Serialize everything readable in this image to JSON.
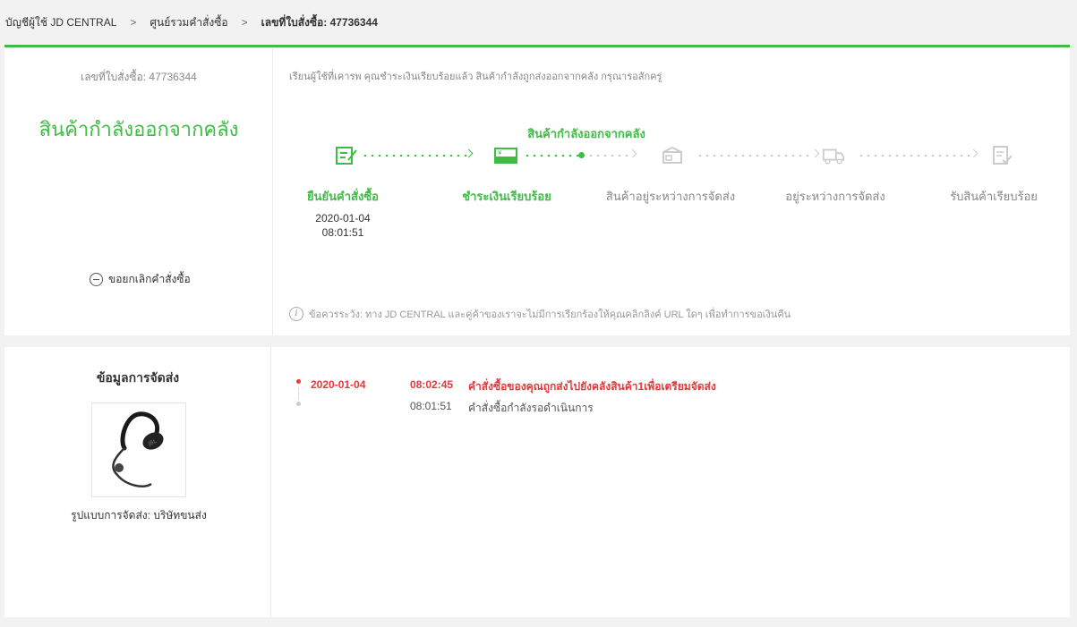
{
  "breadcrumb": {
    "account": "บัญชีผู้ใช้ JD CENTRAL",
    "separator": ">",
    "orders": "ศูนย์รวมคำสั่งซื้อ",
    "current": "เลขที่ใบสั่งซื้อ: 47736344"
  },
  "order": {
    "number_label": "เลขที่ใบสั่งซื้อ: 47736344",
    "status": "สินค้ากำลังออกจากคลัง",
    "cancel_label": "ขอยกเลิกคำสั่งซื้อ"
  },
  "progress": {
    "greeting": "เรียนผู้ใช้ที่เคารพ คุณชำระเงินเรียบร้อยแล้ว สินค้ากำลังถูกส่งออกจากคลัง กรุณารอสักครู่",
    "current_label": "สินค้ากำลังออกจากคลัง",
    "steps": [
      {
        "label": "ยืนยันคำสั่งซื้อ",
        "date": "2020-01-04",
        "time": "08:01:51",
        "icon": "order-confirm-icon",
        "done": true
      },
      {
        "label": "ชำระเงินเรียบร้อย",
        "icon": "payment-icon",
        "done": true
      },
      {
        "label": "สินค้าอยู่ระหว่างการจัดส่ง",
        "icon": "package-icon",
        "done": false
      },
      {
        "label": "อยู่ระหว่างการจัดส่ง",
        "icon": "delivery-truck-icon",
        "done": false
      },
      {
        "label": "รับสินค้าเรียบร้อย",
        "icon": "received-checklist-icon",
        "done": false
      }
    ],
    "notice": "ข้อควรระวัง: ทาง JD CENTRAL และคู่ค้าของเราจะไม่มีการเรียกร้องให้คุณคลิกลิงค์ URL ใดๆ เพื่อทำการขอเงินคืน"
  },
  "shipping": {
    "title": "ข้อมูลการจัดส่ง",
    "method": "รูปแบบการจัดส่ง: บริษัทขนส่ง",
    "product_image": "earphone-product-image"
  },
  "tracking": [
    {
      "date": "2020-01-04",
      "time": "08:02:45",
      "text": "คำสั่งซื้อของคุณถูกส่งไปยังคลังสินค้า1เพื่อเตรียมจัดส่ง"
    },
    {
      "date": "",
      "time": "08:01:51",
      "text": "คำสั่งซื้อกำลังรอดำเนินการ"
    }
  ],
  "colors": {
    "accent_green": "#3ebd45",
    "alert_red": "#e4393c",
    "inactive_gray": "#cccccc"
  }
}
